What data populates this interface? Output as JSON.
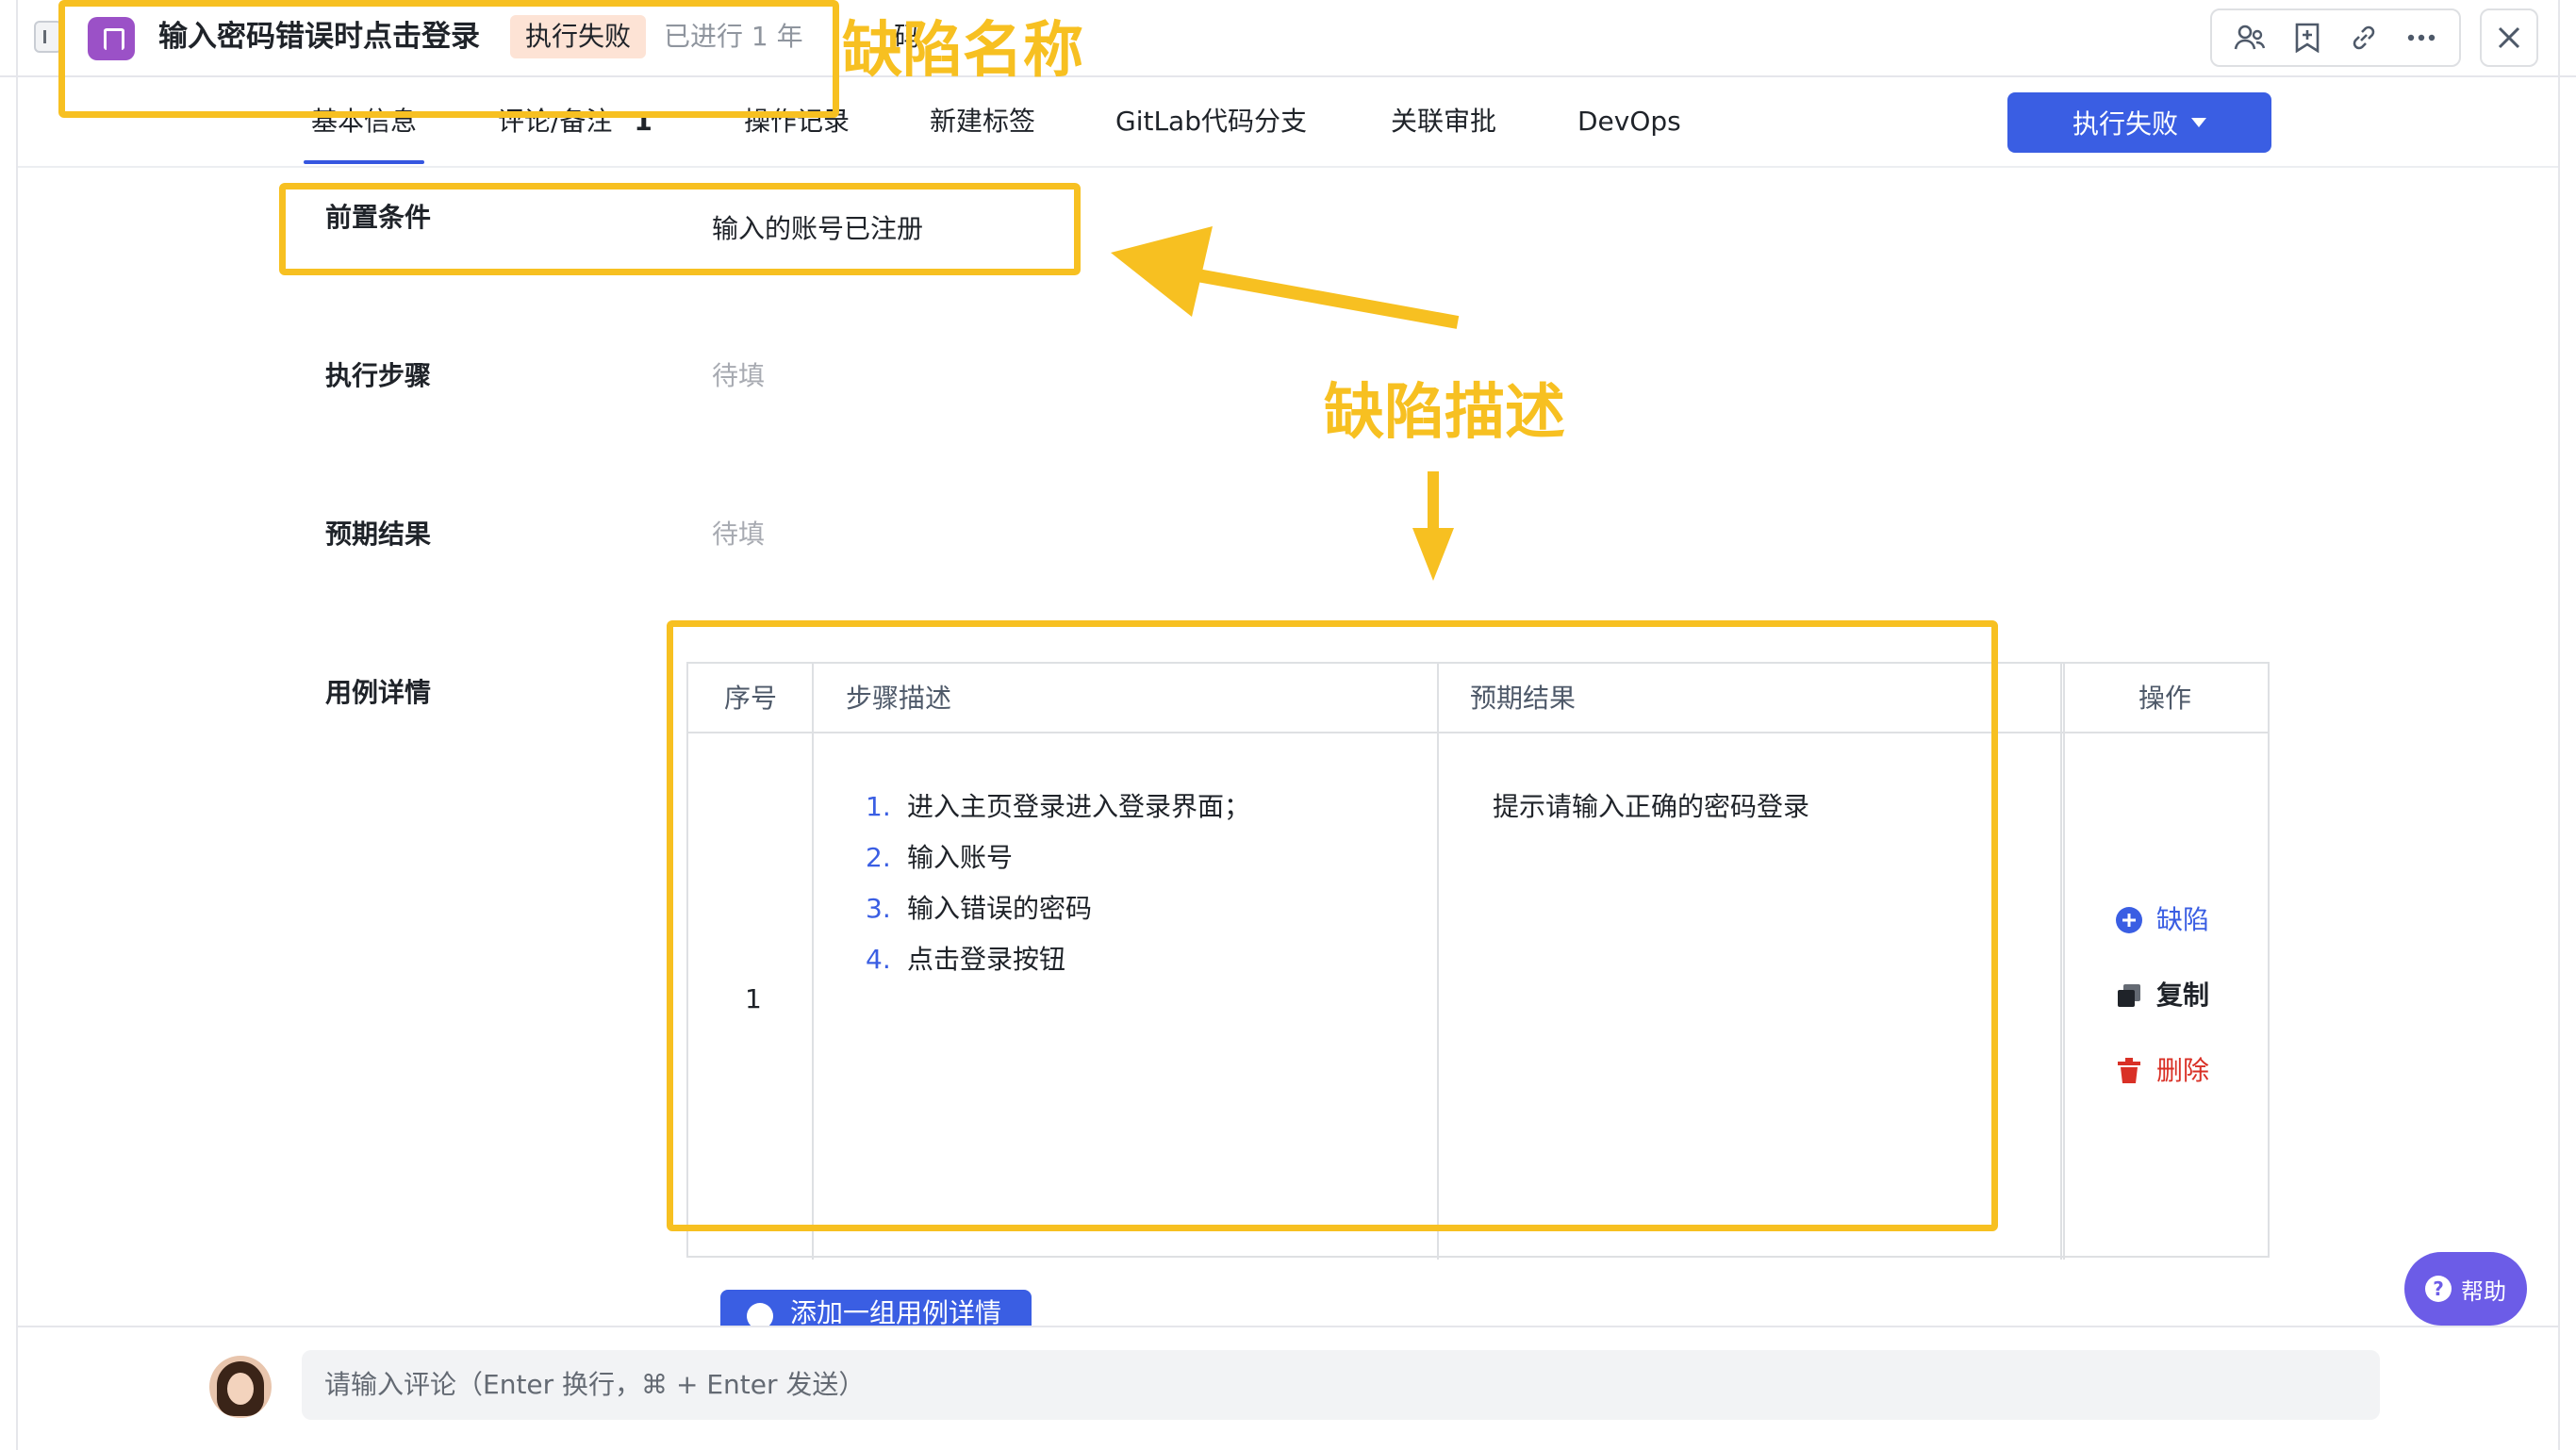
{
  "header": {
    "title": "输入密码错误时点击登录",
    "status": "执行失败",
    "elapsed": "已进行 1 年",
    "hidden_tab_fragment": "码"
  },
  "tabs": [
    {
      "label": "基本信息",
      "active": true
    },
    {
      "label": "评论/备注",
      "badge": "1"
    },
    {
      "label": "操作记录"
    },
    {
      "label": "新建标签"
    },
    {
      "label": "GitLab代码分支"
    },
    {
      "label": "关联审批"
    },
    {
      "label": "DevOps"
    }
  ],
  "status_button": {
    "label": "执行失败"
  },
  "fields": {
    "precondition": {
      "label": "前置条件",
      "value": "输入的账号已注册"
    },
    "steps": {
      "label": "执行步骤",
      "value": "待填"
    },
    "expected": {
      "label": "预期结果",
      "value": "待填"
    },
    "case_details": {
      "label": "用例详情"
    }
  },
  "table": {
    "headers": {
      "index": "序号",
      "step_desc": "步骤描述",
      "expected": "预期结果",
      "actions": "操作"
    },
    "rows": [
      {
        "index": "1",
        "steps": [
          {
            "num": "1.",
            "text": "进入主页登录进入登录界面；"
          },
          {
            "num": "2.",
            "text": "输入账号"
          },
          {
            "num": "3.",
            "text": "输入错误的密码"
          },
          {
            "num": "4.",
            "text": "点击登录按钮"
          }
        ],
        "expected": "提示请输入正确的密码登录"
      }
    ],
    "actions": {
      "defect": "缺陷",
      "copy": "复制",
      "delete": "删除"
    },
    "add_group": "添加一组用例详情"
  },
  "comment": {
    "placeholder": "请输入评论（Enter 换行，⌘ + Enter 发送）"
  },
  "help": {
    "label": "帮助"
  },
  "annotations": {
    "defect_name": "缺陷名称",
    "defect_desc": "缺陷描述"
  },
  "colors": {
    "primary": "#3a5ee3",
    "annotation": "#f7c021",
    "type_icon": "#9b51c7",
    "delete": "#d93026",
    "status_badge_bg": "#fde3d5"
  }
}
